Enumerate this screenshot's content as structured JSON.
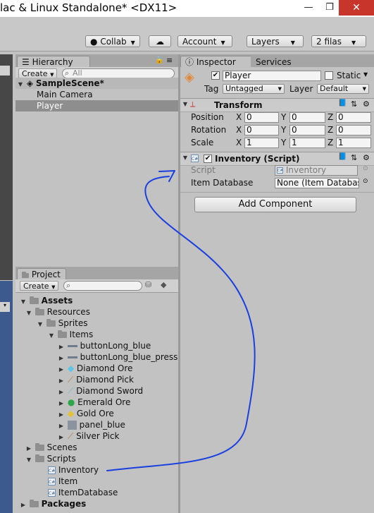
{
  "window": {
    "title": "lac & Linux Standalone* <DX11>",
    "minimize": "—",
    "restore": "❐",
    "close": "✕"
  },
  "toolbar": {
    "collab": "Collab",
    "cloud": "☁",
    "account": "Account",
    "layers": "Layers",
    "layout": "2 filas"
  },
  "hierarchy": {
    "tab": "Hierarchy",
    "create": "Create",
    "search_placeholder": "All",
    "scene": "SampleScene*",
    "items": [
      "Main Camera",
      "Player"
    ],
    "selected": "Player"
  },
  "project": {
    "tab": "Project",
    "create": "Create",
    "tree": {
      "assets": "Assets",
      "resources": "Resources",
      "sprites": "Sprites",
      "items_folder": "Items",
      "sprites_list": [
        "buttonLong_blue",
        "buttonLong_blue_presse",
        "Diamond Ore",
        "Diamond Pick",
        "Diamond Sword",
        "Emerald Ore",
        "Gold Ore",
        "panel_blue",
        "Silver Pick"
      ],
      "scenes": "Scenes",
      "scripts": "Scripts",
      "scripts_list": [
        "Inventory",
        "Item",
        "ItemDatabase"
      ],
      "packages": "Packages"
    }
  },
  "inspector": {
    "tab": "Inspector",
    "tab2": "Services",
    "object_name": "Player",
    "static_label": "Static",
    "tag_label": "Tag",
    "tag_value": "Untagged",
    "layer_label": "Layer",
    "layer_value": "Default",
    "transform": {
      "title": "Transform",
      "rows": [
        {
          "label": "Position",
          "x": "0",
          "y": "0",
          "z": "0"
        },
        {
          "label": "Rotation",
          "x": "0",
          "y": "0",
          "z": "0"
        },
        {
          "label": "Scale",
          "x": "1",
          "y": "1",
          "z": "1"
        }
      ],
      "axis_x": "X",
      "axis_y": "Y",
      "axis_z": "Z"
    },
    "inventory": {
      "title": "Inventory (Script)",
      "script_label": "Script",
      "script_value": "Inventory",
      "db_label": "Item Database",
      "db_value": "None (Item Databas"
    },
    "add_component": "Add Component"
  },
  "colors": {
    "selection": "#8e8e8e",
    "annotation": "#1a3fe0",
    "close_button": "#c7352b"
  }
}
